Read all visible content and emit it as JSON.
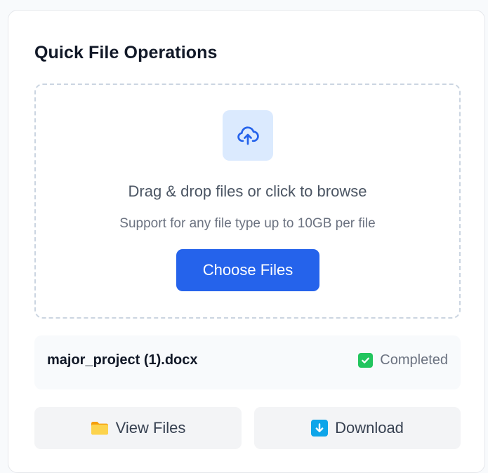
{
  "panel": {
    "title": "Quick File Operations"
  },
  "dropzone": {
    "icon": "cloud-upload-icon",
    "primary_text": "Drag & drop files or click to browse",
    "secondary_text": "Support for any file type up to 10GB per file",
    "button_label": "Choose Files"
  },
  "file": {
    "name": "major_project (1).docx",
    "status": "Completed",
    "status_icon": "check-icon"
  },
  "actions": {
    "view_label": "View Files",
    "view_icon": "folder-icon",
    "download_label": "Download",
    "download_icon": "download-arrow-icon"
  },
  "colors": {
    "primary": "#2563eb",
    "icon_tile": "#dbeafe",
    "success": "#22c55e",
    "download_icon_bg": "#0ea5e9",
    "folder": "#fbbf24"
  }
}
